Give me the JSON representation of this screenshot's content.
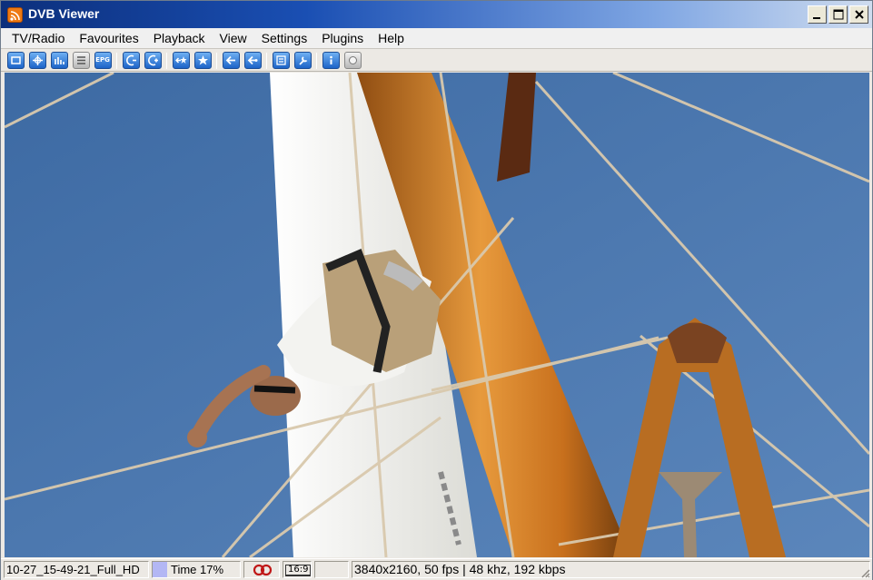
{
  "window": {
    "title": "DVB Viewer",
    "icon": "rss-feed-icon",
    "controls": [
      "minimize-icon",
      "maximize-icon",
      "close-icon"
    ]
  },
  "menu": [
    "TV/Radio",
    "Favourites",
    "Playback",
    "View",
    "Settings",
    "Plugins",
    "Help"
  ],
  "toolbar": {
    "epg_label": "EPG"
  },
  "status": {
    "filename": "10-27_15-49-21_Full_HD",
    "time_label": "Time 17%",
    "time_progress": 17,
    "aspect_ratio": "16:9",
    "stream_info": "3840x2160, 50 fps | 48 khz, 192 kbps"
  },
  "colors": {
    "sky": "#4e78ac",
    "title_start": "#0c2f7c",
    "title_end": "#cfdcef",
    "progress_fill": "#b3b7f4",
    "audio_indicator": "#c01818"
  }
}
